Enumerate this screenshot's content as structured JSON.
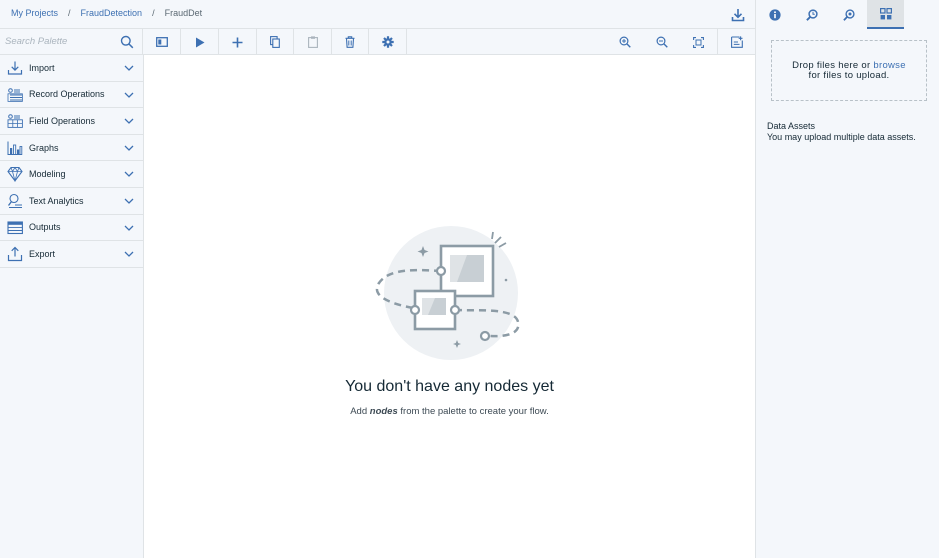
{
  "breadcrumb": {
    "items": [
      "My Projects",
      "FraudDetection",
      "FraudDet"
    ],
    "separator": "/"
  },
  "toolbar": {
    "search_placeholder": "Search Palette",
    "tools": [
      "toggle-palette-icon",
      "run-icon",
      "add-icon",
      "copy-icon",
      "paste-icon",
      "delete-icon",
      "settings-icon",
      "zoom-in-icon",
      "zoom-out-icon",
      "fit-to-screen-icon",
      "comment-icon"
    ]
  },
  "palette": {
    "items": [
      {
        "label": "Import",
        "icon": "import-icon"
      },
      {
        "label": "Record Operations",
        "icon": "record-operations-icon"
      },
      {
        "label": "Field Operations",
        "icon": "field-operations-icon"
      },
      {
        "label": "Graphs",
        "icon": "graphs-icon"
      },
      {
        "label": "Modeling",
        "icon": "modeling-icon"
      },
      {
        "label": "Text Analytics",
        "icon": "text-analytics-icon"
      },
      {
        "label": "Outputs",
        "icon": "outputs-icon"
      },
      {
        "label": "Export",
        "icon": "export-icon"
      }
    ]
  },
  "canvas": {
    "empty_title": "You don't have any nodes yet",
    "empty_sub_before": "Add ",
    "empty_sub_em": "nodes",
    "empty_sub_after": " from the palette to create your flow."
  },
  "right_panel": {
    "tabs": [
      "info-icon",
      "search-history-icon",
      "comments-icon",
      "data-assets-icon"
    ],
    "active_tab": 3,
    "drop_line1_before": "Drop files here or ",
    "drop_browse": "browse",
    "drop_line2": "for files to upload.",
    "assets_heading": "Data Assets",
    "assets_note": "You may upload multiple data assets."
  },
  "colors": {
    "accent": "#3d70b2",
    "panel_bg": "#f4f7fb",
    "border": "#dfe3e6",
    "icon": "#3d70b2",
    "text": "#152935"
  }
}
